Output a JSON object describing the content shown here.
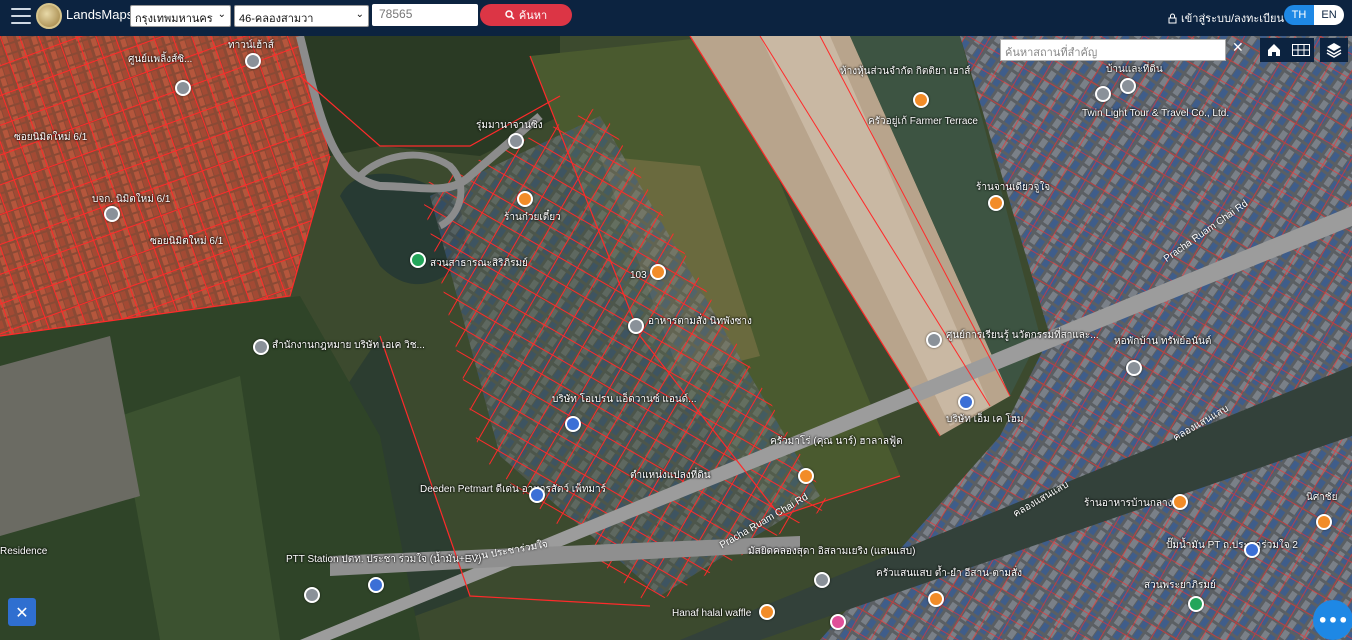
{
  "app": {
    "name": "LandsMaps"
  },
  "header": {
    "province_select": "กรุงเทพมหานคร",
    "district_select": "46-คลองสามวา",
    "parcel_input": "78565",
    "search_label": "ค้นหา",
    "login_label": "เข้าสู่ระบบ/ลงทะเบียน",
    "lang_th": "TH",
    "lang_en": "EN"
  },
  "map_tools": {
    "place_search_placeholder": "ค้นหาสถานที่สำคัญ",
    "clear": "✕"
  },
  "places": [
    {
      "text": "ศูนย์แพลิ้งส์ซิ..."
    },
    {
      "text": "ทาวน์เฮ้าส์"
    },
    {
      "text": "ซอยนิมิตใหม่ 6/1"
    },
    {
      "text": "บจก. นิมิตใหม่ 6/1"
    },
    {
      "text": "ซอยนิมิตใหม่ 6/1"
    },
    {
      "text": "รุ่มมานาจานซิง"
    },
    {
      "text": "ร้านก๋วยเตี๋ยว"
    },
    {
      "text": "สวนสาธารณะสิริภิรมย์"
    },
    {
      "text": "103"
    },
    {
      "text": "อาหารตามสั่ง นิทพังซาง"
    },
    {
      "text": "สำนักงานกฎหมาย บริษัท เอเค วิช..."
    },
    {
      "text": "บริษัท โอเปรน แอ็ดวานซ์ แอนด์..."
    },
    {
      "text": "ห้างหุ้นส่วนจำกัด กิตติยา เฮาส์"
    },
    {
      "text": "ครัวอยู่เก้ Farmer Terrace"
    },
    {
      "text": "ร้านจานเดียวจูใจ"
    },
    {
      "text": "บ้านและที่ดิน"
    },
    {
      "text": "Twin Light Tour & Travel Co., Ltd."
    },
    {
      "text": "Pracha Ruam Chai Rd"
    },
    {
      "text": "ศูนย์การเรียนรู้ นวัตกรรมที่สาและ..."
    },
    {
      "text": "บริษัท เอ็ม เค โฮม"
    },
    {
      "text": "หอพักบ้าน ทรัพย์อนันต์"
    },
    {
      "text": "ครัวมาโร่ (คุณ นาร์) ฮาลาลฟู้ด"
    },
    {
      "text": "ตำแหน่งแปลงที่ดิน"
    },
    {
      "text": "Deeden Petmart ดีเด่น อาหารสัตว์ เพ็ทมาร์"
    },
    {
      "text": "Pracha Ruam Chai Rd"
    },
    {
      "text": "ถนน ประชาร่วมใจ"
    },
    {
      "text": "PTT Station ปตท. ประชา ร่วมใจ (น้ำมัน+EV)"
    },
    {
      "text": "มัสยิดคลองสุดา อิสลามเยริง (แสนแสบ)"
    },
    {
      "text": "ครัวแสนแสบ ต้ำ-ยำ อีสาน-ตามสั่ง"
    },
    {
      "text": "Hanaf halal waffle"
    },
    {
      "text": "ร้านอาหารบ้านกลาง"
    },
    {
      "text": "ปั๊มน้ำมัน PT ถ.ประชาร่วมใจ 2"
    },
    {
      "text": "สวนพระยาภิรมย์"
    },
    {
      "text": "นิศาชัย"
    },
    {
      "text": "Residence"
    },
    {
      "text": "คลองแสนแสบ"
    },
    {
      "text": "คลองแสนแสบ"
    }
  ],
  "icons": {
    "menu": "hamburger-icon",
    "logo": "landsmaps-logo",
    "search": "magnifier-icon",
    "lock": "lock-icon",
    "home": "home-icon",
    "grid": "grid-icon",
    "layers": "layers-icon",
    "tool": "tools-icon",
    "more": "more-dots-icon"
  }
}
